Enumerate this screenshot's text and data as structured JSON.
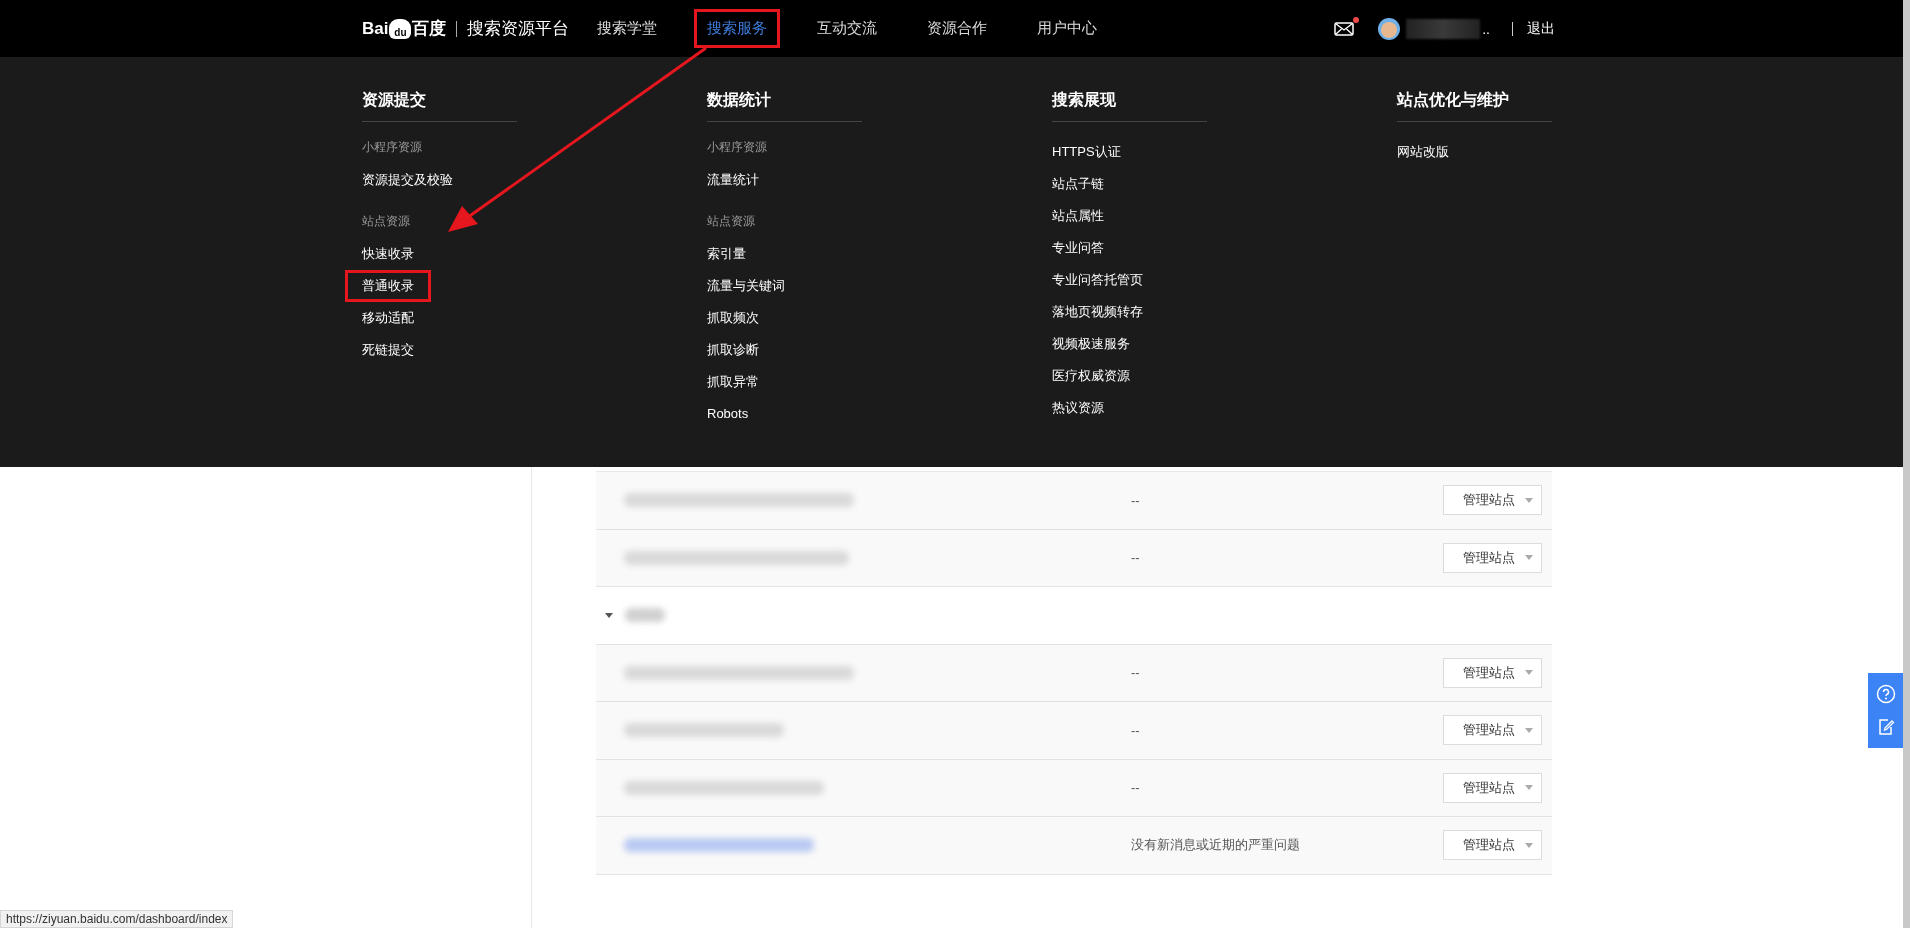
{
  "header": {
    "logo": {
      "mark_left": "Bai",
      "mark_paw": "du",
      "mark_right": "百度"
    },
    "platform": "搜索资源平台",
    "nav": [
      {
        "label": "搜索学堂",
        "selected": false,
        "highlighted": false
      },
      {
        "label": "搜索服务",
        "selected": true,
        "highlighted": true
      },
      {
        "label": "互动交流",
        "selected": false,
        "highlighted": false
      },
      {
        "label": "资源合作",
        "selected": false,
        "highlighted": false
      },
      {
        "label": "用户中心",
        "selected": false,
        "highlighted": false
      }
    ],
    "mail_unread": true,
    "username_suffix": "..",
    "logout": "退出"
  },
  "mega_menu": {
    "columns": [
      {
        "title": "资源提交",
        "groups": [
          {
            "label": "小程序资源",
            "items": [
              {
                "label": "资源提交及校验",
                "highlighted": false
              }
            ]
          },
          {
            "label": "站点资源",
            "items": [
              {
                "label": "快速收录",
                "highlighted": false
              },
              {
                "label": "普通收录",
                "highlighted": true
              },
              {
                "label": "移动适配",
                "highlighted": false
              },
              {
                "label": "死链提交",
                "highlighted": false
              }
            ]
          }
        ]
      },
      {
        "title": "数据统计",
        "groups": [
          {
            "label": "小程序资源",
            "items": [
              {
                "label": "流量统计",
                "highlighted": false
              }
            ]
          },
          {
            "label": "站点资源",
            "items": [
              {
                "label": "索引量",
                "highlighted": false
              },
              {
                "label": "流量与关键词",
                "highlighted": false
              },
              {
                "label": "抓取频次",
                "highlighted": false
              },
              {
                "label": "抓取诊断",
                "highlighted": false
              },
              {
                "label": "抓取异常",
                "highlighted": false
              },
              {
                "label": "Robots",
                "highlighted": false
              }
            ]
          }
        ]
      },
      {
        "title": "搜索展现",
        "groups": [
          {
            "items": [
              {
                "label": "HTTPS认证",
                "highlighted": false
              },
              {
                "label": "站点子链",
                "highlighted": false
              },
              {
                "label": "站点属性",
                "highlighted": false
              },
              {
                "label": "专业问答",
                "highlighted": false
              },
              {
                "label": "专业问答托管页",
                "highlighted": false
              },
              {
                "label": "落地页视频转存",
                "highlighted": false
              },
              {
                "label": "视频极速服务",
                "highlighted": false
              },
              {
                "label": "医疗权威资源",
                "highlighted": false
              },
              {
                "label": "热议资源",
                "highlighted": false
              }
            ]
          }
        ]
      },
      {
        "title": "站点优化与维护",
        "groups": [
          {
            "items": [
              {
                "label": "网站改版",
                "highlighted": false
              }
            ]
          }
        ]
      }
    ]
  },
  "site_table": {
    "rows": [
      {
        "kind": "site",
        "linked": false,
        "status": "--",
        "action": "管理站点"
      },
      {
        "kind": "site",
        "linked": false,
        "status": "--",
        "action": "管理站点"
      },
      {
        "kind": "group"
      },
      {
        "kind": "site",
        "linked": false,
        "status": "--",
        "action": "管理站点"
      },
      {
        "kind": "site",
        "linked": false,
        "status": "--",
        "action": "管理站点"
      },
      {
        "kind": "site",
        "linked": false,
        "status": "--",
        "action": "管理站点"
      },
      {
        "kind": "site",
        "linked": true,
        "status": "没有新消息或近期的严重问题",
        "action": "管理站点"
      }
    ]
  },
  "status_url": "https://ziyuan.baidu.com/dashboard/index"
}
